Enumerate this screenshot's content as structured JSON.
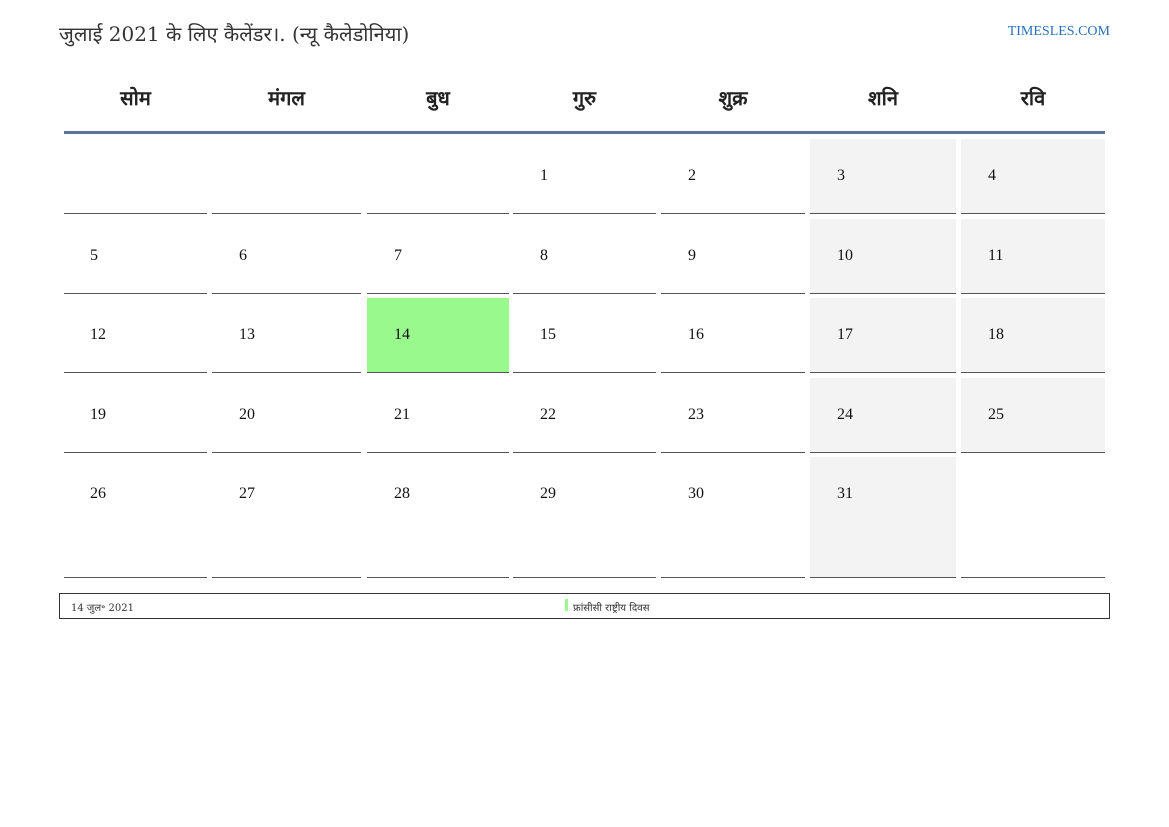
{
  "title": "जुलाई 2021 के लिए कैलेंडर।. (न्यू कैलेडोनिया)",
  "brand": "TIMESLES.COM",
  "colors": {
    "accent_link": "#2a6ebb",
    "header_rule": "#5b7592",
    "weekend_bg": "#f3f3f3",
    "highlight_bg": "#99f98d"
  },
  "weekdays": [
    "सोम",
    "मंगल",
    "बुध",
    "गुरु",
    "शुक्र",
    "शनि",
    "रवि"
  ],
  "weeks": [
    [
      "",
      "",
      "",
      "1",
      "2",
      "3",
      "4"
    ],
    [
      "5",
      "6",
      "7",
      "8",
      "9",
      "10",
      "11"
    ],
    [
      "12",
      "13",
      "14",
      "15",
      "16",
      "17",
      "18"
    ],
    [
      "19",
      "20",
      "21",
      "22",
      "23",
      "24",
      "25"
    ],
    [
      "26",
      "27",
      "28",
      "29",
      "30",
      "31",
      ""
    ]
  ],
  "highlighted_day": "14",
  "legend": {
    "date": "14 जुल॰ 2021",
    "event": "फ्रांसीसी राष्ट्रीय दिवस"
  }
}
